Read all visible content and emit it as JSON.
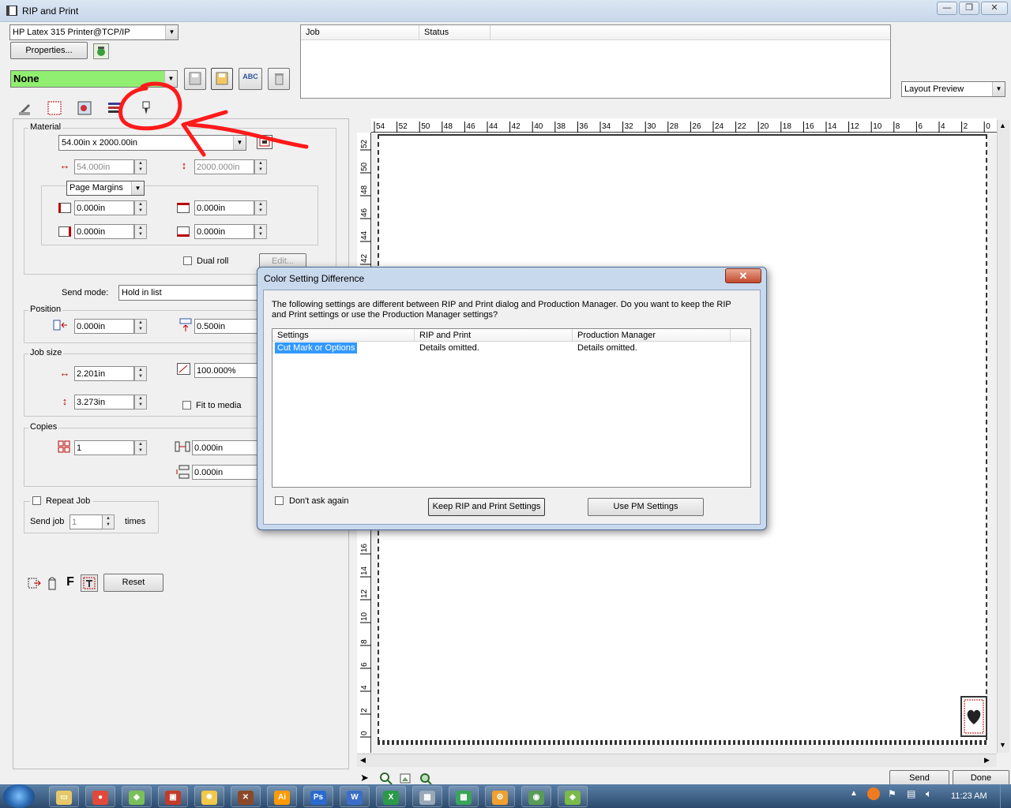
{
  "window": {
    "title": "RIP and Print",
    "min": "—",
    "max": "❐",
    "close": "✕"
  },
  "printer": {
    "selected": "HP Latex 315 Printer@TCP/IP",
    "properties_label": "Properties..."
  },
  "preset": {
    "selected": "None",
    "preset_color": "#90ee70"
  },
  "job_list": {
    "columns": [
      "Job",
      "Status"
    ]
  },
  "preview_mode": {
    "selected": "Layout Preview"
  },
  "material": {
    "group_label": "Material",
    "size_selected": "54.00in x 2000.00in",
    "width": "54.000in",
    "length": "2000.000in",
    "margins_selected": "Page Margins",
    "margin_left": "0.000in",
    "margin_top": "0.000in",
    "margin_bottom_left": "0.000in",
    "margin_bottom": "0.000in",
    "dual_roll_label": "Dual roll",
    "edit_label": "Edit..."
  },
  "send_mode": {
    "label": "Send mode:",
    "selected": "Hold in list"
  },
  "position": {
    "group_label": "Position",
    "x": "0.000in",
    "y": "0.500in"
  },
  "job_size": {
    "group_label": "Job size",
    "width": "2.201in",
    "scale": "100.000%",
    "height": "3.273in",
    "fit_label": "Fit to media"
  },
  "copies": {
    "group_label": "Copies",
    "count": "1",
    "h_spacing": "0.000in",
    "v_spacing": "0.000in"
  },
  "repeat": {
    "label": "Repeat Job",
    "send_job": "Send job",
    "value": "1",
    "times": "times"
  },
  "bottom_tools": {
    "f_label": "F",
    "reset_label": "Reset"
  },
  "ruler": {
    "top_ticks": [
      "54",
      "52",
      "50",
      "48",
      "46",
      "44",
      "42",
      "40",
      "38",
      "36",
      "34",
      "32",
      "30",
      "28",
      "26",
      "24",
      "22",
      "20",
      "18",
      "16",
      "14",
      "12",
      "10",
      "8",
      "6",
      "4",
      "2",
      "0"
    ],
    "left_ticks_upper": [
      "52",
      "50",
      "48",
      "46",
      "44",
      "42"
    ],
    "left_ticks_lower": [
      "16",
      "14",
      "12",
      "10",
      "8",
      "6",
      "4",
      "2",
      "0"
    ]
  },
  "footer": {
    "send_label": "Send",
    "done_label": "Done"
  },
  "dialog": {
    "title": "Color Setting Difference",
    "message": "The following settings are different between RIP and Print dialog and Production Manager. Do you want to keep the RIP and Print settings or use the Production Manager settings?",
    "columns": [
      "Settings",
      "RIP and Print",
      "Production Manager"
    ],
    "rows": [
      {
        "setting": "Cut Mark or Options",
        "rip": "Details omitted.",
        "pm": "Details omitted."
      }
    ],
    "dont_ask_label": "Don't ask again",
    "keep_button": "Keep RIP and Print Settings",
    "use_pm_button": "Use PM Settings"
  },
  "taskbar": {
    "apps": [
      "Explorer",
      "Chrome",
      "RIP",
      "Flexi",
      "Sun",
      "Xara",
      "Ai",
      "Ps",
      "W",
      "X",
      "Calc",
      "PM",
      "Gear",
      "Net",
      "Tool"
    ],
    "clock": "11:23 AM"
  },
  "annotation_color": "#ff1a1a"
}
